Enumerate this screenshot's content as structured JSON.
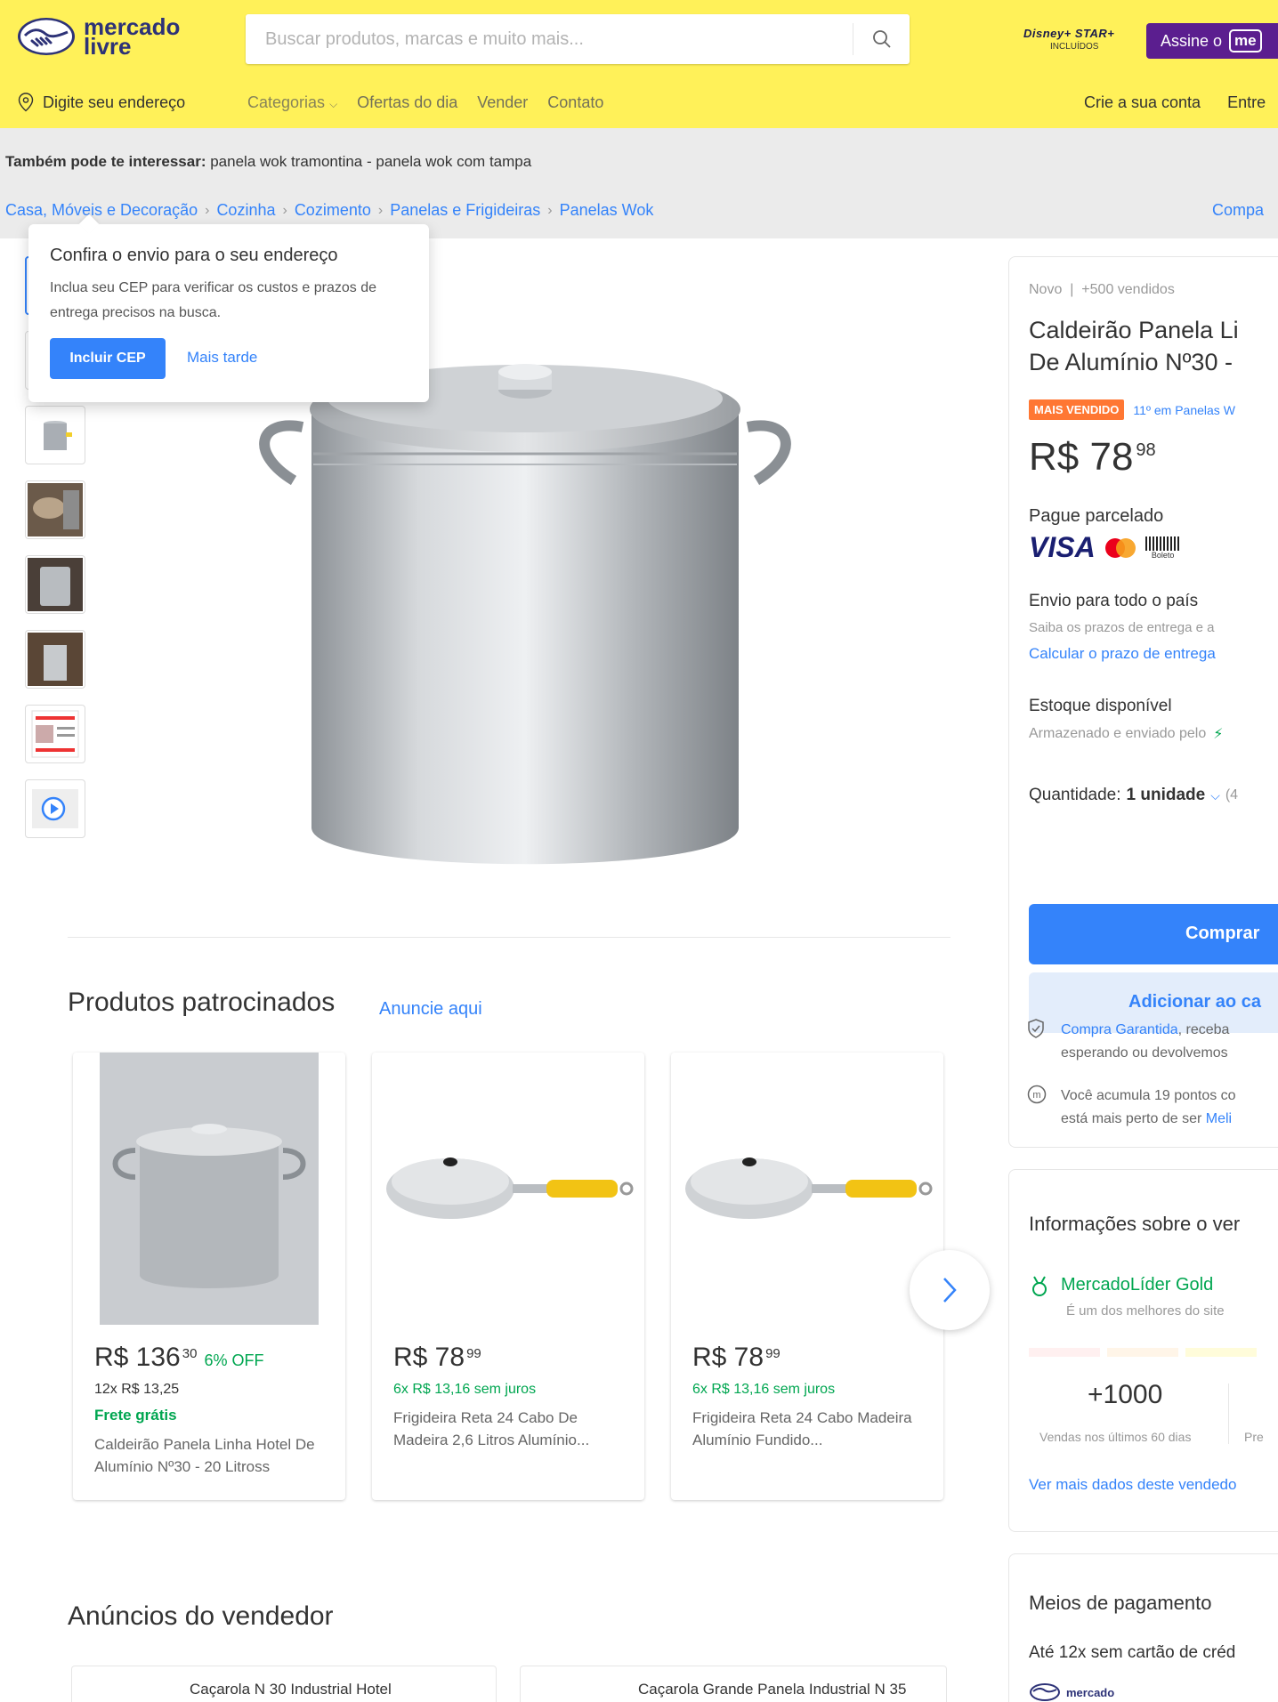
{
  "header": {
    "logo_line1": "mercado",
    "logo_line2": "livre",
    "search_placeholder": "Buscar produtos, marcas e muito mais...",
    "disney_brand": "Disney+ STAR+",
    "disney_sub": "INCLUÍDOS",
    "assine_label": "Assine o",
    "assine_badge": "me",
    "address_label": "Digite seu endereço",
    "menu": [
      "Categorias",
      "Ofertas do dia",
      "Vender",
      "Contato"
    ],
    "account": [
      "Crie a sua conta",
      "Entre"
    ]
  },
  "band": {
    "interest_prefix": "Também pode te interessar:",
    "interest_links": "panela wok tramontina - panela wok com tampa",
    "breadcrumbs": [
      "Casa, Móveis e Decoração",
      "Cozinha",
      "Cozimento",
      "Panelas e Frigideiras",
      "Panelas Wok"
    ],
    "share_label": "Compa"
  },
  "popup": {
    "title": "Confira o envio para o seu endereço",
    "text": "Inclua seu CEP para verificar os custos e prazos de entrega precisos na busca.",
    "primary": "Incluir CEP",
    "secondary": "Mais tarde"
  },
  "sponsored": {
    "title": "Produtos patrocinados",
    "link": "Anuncie aqui",
    "items": [
      {
        "price": "R$ 136",
        "cents": "30",
        "discount": "6% OFF",
        "installments": "12x R$ 13,25",
        "shipping": "Frete grátis",
        "title": "Caldeirão Panela Linha Hotel De Alumínio Nº30 - 20 Litross"
      },
      {
        "price": "R$ 78",
        "cents": "99",
        "discount": "",
        "installments": "6x R$ 13,16 sem juros",
        "shipping": "",
        "title": "Frigideira Reta 24 Cabo De Madeira 2,6 Litros Alumínio..."
      },
      {
        "price": "R$ 78",
        "cents": "99",
        "discount": "",
        "installments": "6x R$ 13,16 sem juros",
        "shipping": "",
        "title": "Frigideira Reta 24 Cabo Madeira Alumínio Fundido..."
      }
    ]
  },
  "seller_ads": {
    "title": "Anúncios do vendedor",
    "items": [
      "Caçarola N 30 Industrial Hotel",
      "Caçarola Grande Panela Industrial N 35"
    ]
  },
  "product": {
    "condition": "Novo",
    "sold": "+500 vendidos",
    "title_line1": "Caldeirão Panela Li",
    "title_line2": "De Alumínio Nº30 -",
    "badge": "MAIS VENDIDO",
    "rank": "11º em Panelas W",
    "price": "R$ 78",
    "cents": "98",
    "installments_label": "Pague parcelado",
    "boleto_label": "Boleto",
    "shipping_title": "Envio para todo o país",
    "shipping_sub": "Saiba os prazos de entrega e a",
    "shipping_link": "Calcular o prazo de entrega",
    "stock_title": "Estoque disponível",
    "stock_sub": "Armazenado e enviado pelo",
    "qty_label": "Quantidade:",
    "qty_value": "1 unidade",
    "qty_avail": "(4",
    "buy": "Comprar",
    "cart": "Adicionar ao ca",
    "guarantee_link": "Compra Garantida",
    "guarantee_rest": ", receba",
    "guarantee_line2": "esperando ou devolvemos",
    "points_line1": "Você acumula 19 pontos co",
    "points_line2": "está mais perto de ser",
    "points_link": "Meli"
  },
  "seller": {
    "title": "Informações sobre o ver",
    "level": "MercadoLíder Gold",
    "level_sub": "É um dos melhores do site",
    "sales": "+1000",
    "sales_label": "Vendas nos últimos 60 dias",
    "next_label": "Pre",
    "more": "Ver mais dados deste vendedo"
  },
  "payment": {
    "title": "Meios de pagamento",
    "text": "Até 12x sem cartão de créd",
    "brand": "mercado"
  },
  "colors": {
    "header_yellow": "#fff159",
    "primary_blue": "#3483fa",
    "green": "#00a650",
    "orange_badge": "#ff7733",
    "assine_purple": "#5b1e8f"
  }
}
